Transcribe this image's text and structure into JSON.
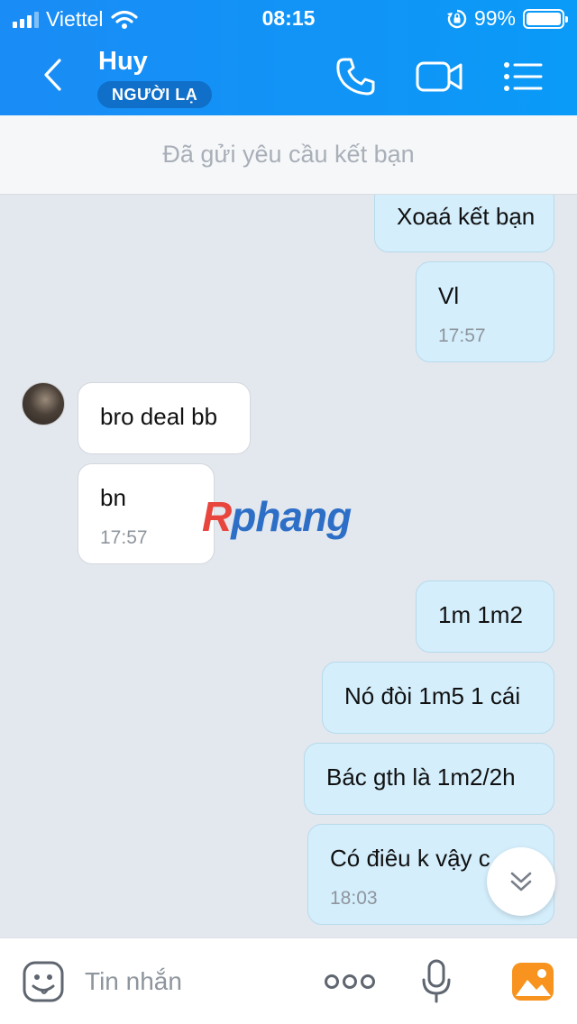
{
  "status_bar": {
    "carrier": "Viettel",
    "time": "08:15",
    "battery_percent": "99%",
    "battery_level": 0.99,
    "icons": [
      "signal-icon",
      "wifi-icon",
      "rotation-lock-icon",
      "battery-icon"
    ]
  },
  "header": {
    "contact_name": "Huy",
    "badge": "NGƯỜI LẠ",
    "icons": [
      "back-icon",
      "phone-icon",
      "video-call-icon",
      "menu-list-icon"
    ]
  },
  "friend_request": {
    "text": "Đã gửi yêu cầu kết bạn"
  },
  "messages": [
    {
      "direction": "out",
      "text": "Xoaá kết bạn",
      "time": ""
    },
    {
      "direction": "out",
      "text": "Vl",
      "time": "17:57"
    },
    {
      "direction": "in",
      "text": "bro deal bb",
      "time": ""
    },
    {
      "direction": "in",
      "text": "bn",
      "time": "17:57"
    },
    {
      "direction": "out",
      "text": "1m 1m2",
      "time": ""
    },
    {
      "direction": "out",
      "text": "Nó đòi 1m5 1 cái",
      "time": ""
    },
    {
      "direction": "out",
      "text": "Bác gth là 1m2/2h",
      "time": ""
    },
    {
      "direction": "out",
      "text": "Có điêu k vậy c",
      "time": "18:03"
    }
  ],
  "watermark": {
    "first": "R",
    "rest": "phang"
  },
  "input_bar": {
    "placeholder": "Tin nhắn",
    "icons": [
      "emoji-icon",
      "more-dots-icon",
      "microphone-icon",
      "photo-icon"
    ]
  },
  "colors": {
    "header": "#1a8cf5",
    "outgoing_bubble": "#d4eefc",
    "incoming_bubble": "#ffffff",
    "chat_background": "#e3e7ee",
    "photo_icon": "#f7931e"
  }
}
